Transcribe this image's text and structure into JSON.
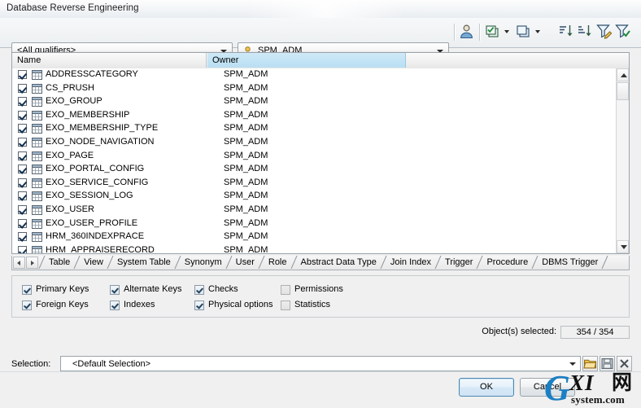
{
  "window": {
    "title": "Database Reverse Engineering"
  },
  "toolbar": {
    "qualifier": {
      "value": "<All qualifiers>",
      "icon": "chevron-down-icon"
    },
    "owner": {
      "value": "SPM_ADM",
      "icon": "user-icon"
    },
    "buttons": [
      {
        "name": "user-filter-button",
        "icon": "user-icon"
      },
      {
        "name": "select-all-button",
        "icon": "layered-squares-green-icon"
      },
      {
        "name": "select-all-dropdown",
        "icon": "chevron-down-icon"
      },
      {
        "name": "deselect-all-button",
        "icon": "layered-squares-blue-icon"
      },
      {
        "name": "deselect-all-dropdown",
        "icon": "chevron-down-icon"
      },
      {
        "name": "sort-ascending-button",
        "icon": "sort-ascending-icon"
      },
      {
        "name": "sort-descending-button",
        "icon": "sort-descending-icon"
      },
      {
        "name": "edit-filter-button",
        "icon": "funnel-pencil-icon"
      },
      {
        "name": "apply-filter-button",
        "icon": "funnel-check-icon"
      }
    ]
  },
  "list": {
    "columns": [
      {
        "label": "Name",
        "selected": false
      },
      {
        "label": "Owner",
        "selected": true
      }
    ],
    "rows": [
      {
        "checked": true,
        "name": "ADDRESSCATEGORY",
        "owner": "SPM_ADM"
      },
      {
        "checked": true,
        "name": "CS_PRUSH",
        "owner": "SPM_ADM"
      },
      {
        "checked": true,
        "name": "EXO_GROUP",
        "owner": "SPM_ADM"
      },
      {
        "checked": true,
        "name": "EXO_MEMBERSHIP",
        "owner": "SPM_ADM"
      },
      {
        "checked": true,
        "name": "EXO_MEMBERSHIP_TYPE",
        "owner": "SPM_ADM"
      },
      {
        "checked": true,
        "name": "EXO_NODE_NAVIGATION",
        "owner": "SPM_ADM"
      },
      {
        "checked": true,
        "name": "EXO_PAGE",
        "owner": "SPM_ADM"
      },
      {
        "checked": true,
        "name": "EXO_PORTAL_CONFIG",
        "owner": "SPM_ADM"
      },
      {
        "checked": true,
        "name": "EXO_SERVICE_CONFIG",
        "owner": "SPM_ADM"
      },
      {
        "checked": true,
        "name": "EXO_SESSION_LOG",
        "owner": "SPM_ADM"
      },
      {
        "checked": true,
        "name": "EXO_USER",
        "owner": "SPM_ADM"
      },
      {
        "checked": true,
        "name": "EXO_USER_PROFILE",
        "owner": "SPM_ADM"
      },
      {
        "checked": true,
        "name": "HRM_360INDEXPRACE",
        "owner": "SPM_ADM"
      },
      {
        "checked": true,
        "name": "HRM_APPRAISERECORD",
        "owner": "SPM_ADM"
      }
    ]
  },
  "tabs": {
    "prev_label": "◄",
    "next_label": "►",
    "items": [
      {
        "label": "Table",
        "active": true
      },
      {
        "label": "View",
        "active": false
      },
      {
        "label": "System Table",
        "active": false
      },
      {
        "label": "Synonym",
        "active": false
      },
      {
        "label": "User",
        "active": false
      },
      {
        "label": "Role",
        "active": false
      },
      {
        "label": "Abstract Data Type",
        "active": false
      },
      {
        "label": "Join Index",
        "active": false
      },
      {
        "label": "Trigger",
        "active": false
      },
      {
        "label": "Procedure",
        "active": false
      },
      {
        "label": "DBMS Trigger",
        "active": false
      }
    ]
  },
  "options": [
    {
      "label": "Primary Keys",
      "checked": true
    },
    {
      "label": "Alternate Keys",
      "checked": true
    },
    {
      "label": "Checks",
      "checked": true
    },
    {
      "label": "Permissions",
      "checked": false
    },
    {
      "label": "Foreign Keys",
      "checked": true
    },
    {
      "label": "Indexes",
      "checked": true
    },
    {
      "label": "Physical options",
      "checked": true
    },
    {
      "label": "Statistics",
      "checked": false
    }
  ],
  "status": {
    "label": "Object(s) selected:",
    "value": "354 / 354"
  },
  "selection": {
    "label": "Selection:",
    "value": "<Default Selection>",
    "buttons": [
      {
        "name": "open-selection-button",
        "icon": "folder-icon"
      },
      {
        "name": "save-selection-button",
        "icon": "save-disk-icon"
      },
      {
        "name": "delete-selection-button",
        "icon": "close-x-icon"
      }
    ]
  },
  "footer": {
    "ok_label": "OK",
    "cancel_label": "Cancel"
  },
  "watermark": {
    "g": "G",
    "xi": "XI",
    "cn": "网",
    "domain": "system.com"
  },
  "colors": {
    "selected_column": "#b9dff2",
    "accent": "#1b7fc4",
    "dialog_bg": "#f0f0f0"
  }
}
